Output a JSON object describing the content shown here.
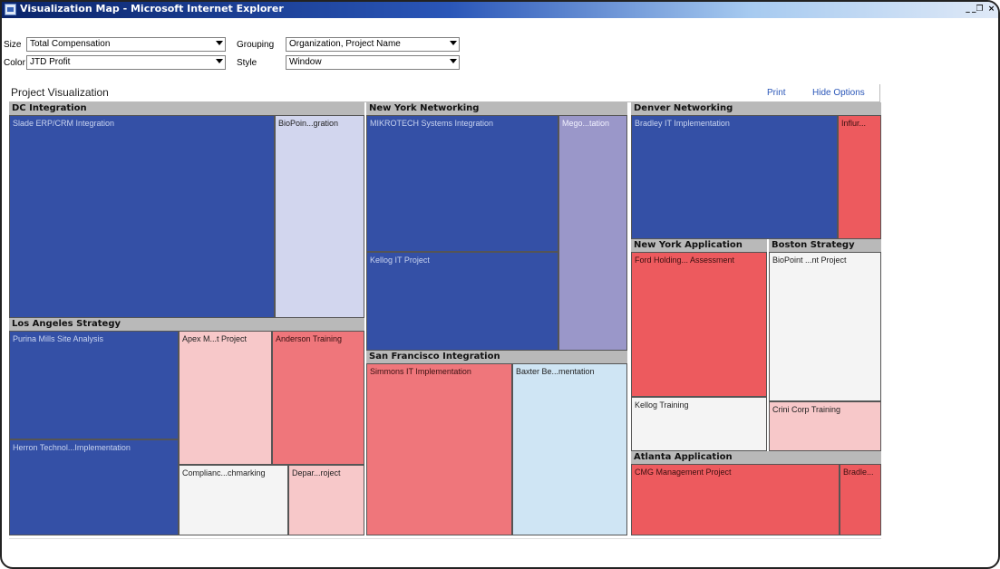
{
  "window": {
    "title": "Visualization Map - Microsoft Internet Explorer",
    "controls": [
      "_",
      "̲❐",
      "×"
    ]
  },
  "options": {
    "size_label": "Size",
    "size_value": "Total Compensation",
    "grouping_label": "Grouping",
    "grouping_value": "Organization, Project Name",
    "color_label": "Color",
    "color_value": "JTD Profit",
    "style_label": "Style",
    "style_value": "Window"
  },
  "panel": {
    "title": "Project Visualization",
    "print_label": "Print",
    "hide_options_label": "Hide Options"
  },
  "colors": {
    "blue": "#3450a6",
    "light_lavender": "#d2d6ee",
    "lavender": "#9a97c9",
    "light_blue": "#cfe5f4",
    "red": "#ed5a5e",
    "salmon": "#ef767b",
    "light_pink": "#f7c8c9",
    "white": "#f4f4f4",
    "header_gray": "#b9b9b9"
  },
  "treemap": {
    "groups": [
      {
        "name": "DC Integration"
      },
      {
        "name": "New York Networking"
      },
      {
        "name": "Denver Networking"
      },
      {
        "name": "Los Angeles Strategy"
      },
      {
        "name": "San Francisco Integration"
      },
      {
        "name": "New York Application"
      },
      {
        "name": "Boston Strategy"
      },
      {
        "name": "Atlanta Application"
      }
    ],
    "cells": [
      {
        "label": "Slade ERP/CRM Integration",
        "color": "blue"
      },
      {
        "label": "BioPoin...gration",
        "color": "light_lavender"
      },
      {
        "label": "MIKROTECH Systems Integration",
        "color": "blue"
      },
      {
        "label": "Mego...tation",
        "color": "lavender"
      },
      {
        "label": "Kellog IT Project",
        "color": "blue"
      },
      {
        "label": "Bradley IT Implementation",
        "color": "blue"
      },
      {
        "label": "Influr...",
        "color": "red"
      },
      {
        "label": "Purina Mills Site Analysis",
        "color": "blue"
      },
      {
        "label": "Apex M...t Project",
        "color": "light_pink"
      },
      {
        "label": "Anderson Training",
        "color": "salmon"
      },
      {
        "label": "Herron Technol...Implementation",
        "color": "blue"
      },
      {
        "label": "Complianc...chmarking",
        "color": "white"
      },
      {
        "label": "Depar...roject",
        "color": "light_pink"
      },
      {
        "label": "Simmons IT Implementation",
        "color": "salmon"
      },
      {
        "label": "Baxter Be...mentation",
        "color": "light_blue"
      },
      {
        "label": "Ford Holding... Assessment",
        "color": "red"
      },
      {
        "label": "Kellog Training",
        "color": "white"
      },
      {
        "label": "BioPoint ...nt Project",
        "color": "white"
      },
      {
        "label": "Crini Corp Training",
        "color": "light_pink"
      },
      {
        "label": "CMG Management Project",
        "color": "red"
      },
      {
        "label": "Bradle...",
        "color": "red"
      }
    ]
  }
}
